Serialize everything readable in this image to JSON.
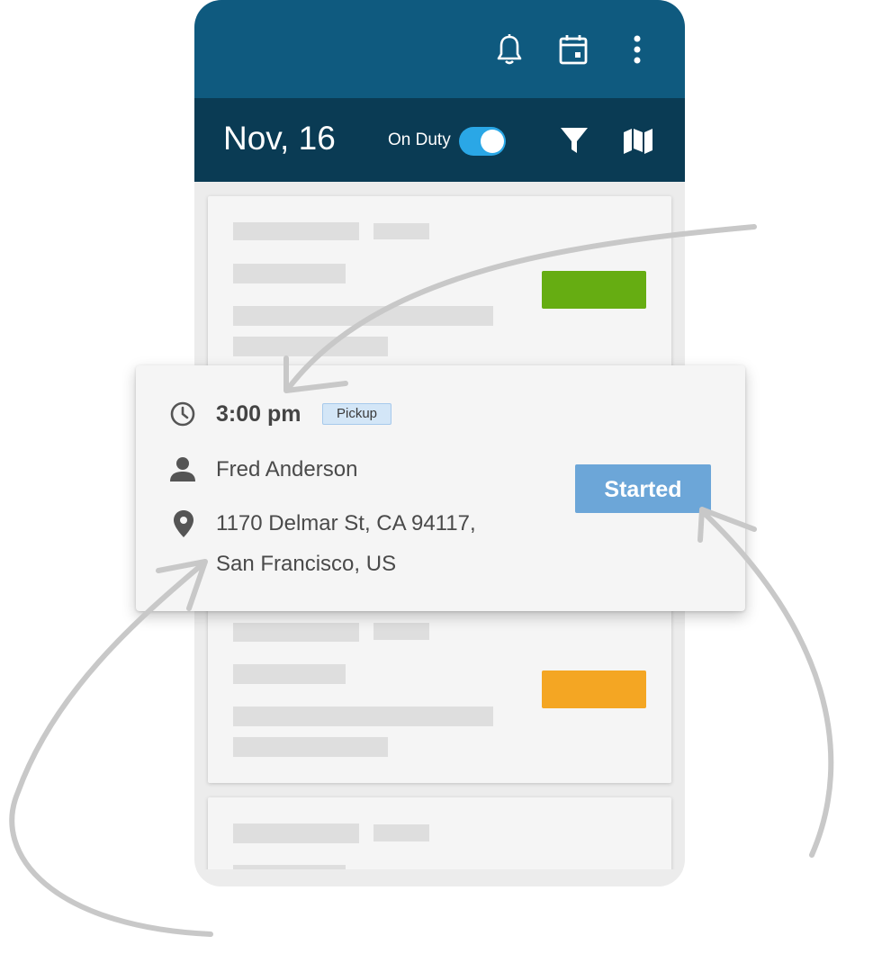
{
  "header": {
    "date": "Nov, 16",
    "duty_label": "On Duty",
    "duty_on": true,
    "icons": [
      "bell-icon",
      "calendar-icon",
      "more-vert-icon",
      "filter-icon",
      "map-icon"
    ]
  },
  "job": {
    "time": "3:00 pm",
    "type_tag": "Pickup",
    "customer": "Fred Anderson",
    "address_line1": "1170 Delmar St, CA 94117,",
    "address_line2": "San Francisco, US",
    "status": "Started"
  },
  "colors": {
    "top_bar": "#0f5a7f",
    "sub_bar": "#0a3b54",
    "toggle": "#2aa7e6",
    "status_button": "#6ca6d8",
    "badge_green": "#66ad12",
    "badge_orange": "#f4a623",
    "tag_bg": "#d3e6f7"
  }
}
